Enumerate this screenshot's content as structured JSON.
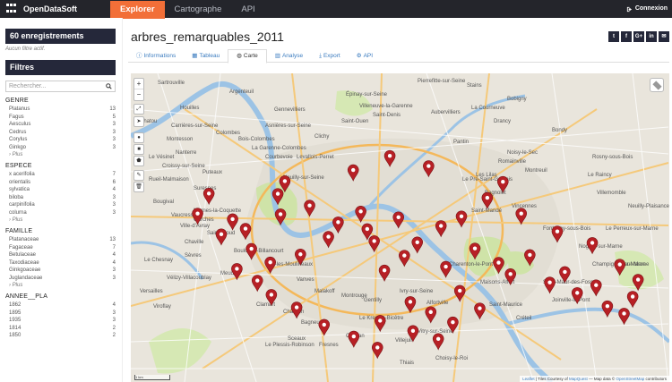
{
  "app": {
    "name": "OpenDataSoft",
    "logo_icon": "opendatasoft-logo-icon"
  },
  "nav": {
    "items": [
      "Explorer",
      "Cartographe",
      "API"
    ],
    "active_index": 0
  },
  "header": {
    "connexion_label": "Connexion"
  },
  "sidebar": {
    "count_label": "60 enregistrements",
    "no_filter": "Aucun filtre actif.",
    "filters_title": "Filtres",
    "search_placeholder": "Rechercher...",
    "groups": [
      {
        "title": "GENRE",
        "items": [
          [
            "Platanus",
            "13"
          ],
          [
            "Fagus",
            "5"
          ],
          [
            "Aesculus",
            "3"
          ],
          [
            "Cedrus",
            "3"
          ],
          [
            "Corylus",
            "3"
          ],
          [
            "Ginkgo",
            "3"
          ]
        ],
        "more": "› Plus"
      },
      {
        "title": "ESPECE",
        "items": [
          [
            "x acerifolia",
            "7"
          ],
          [
            "orientalis",
            "6"
          ],
          [
            "sylvatica",
            "4"
          ],
          [
            "biloba",
            "3"
          ],
          [
            "carpinifolia",
            "3"
          ],
          [
            "colurna",
            "3"
          ]
        ],
        "more": "› Plus"
      },
      {
        "title": "FAMILLE",
        "items": [
          [
            "Platanaceae",
            "13"
          ],
          [
            "Fagaceae",
            "7"
          ],
          [
            "Betulaceae",
            "4"
          ],
          [
            "Taxodiaceae",
            "4"
          ],
          [
            "Ginkgoaceae",
            "3"
          ],
          [
            "Juglandaceae",
            "3"
          ]
        ],
        "more": "› Plus"
      },
      {
        "title": "ANNEE__PLA",
        "items": [
          [
            "1862",
            "4"
          ],
          [
            "1895",
            "3"
          ],
          [
            "1935",
            "3"
          ],
          [
            "1814",
            "2"
          ],
          [
            "1850",
            "2"
          ]
        ],
        "more": ""
      }
    ]
  },
  "main": {
    "title": "arbres_remarquables_2011",
    "social": [
      "t",
      "f",
      "G+",
      "in",
      "✉"
    ],
    "tabs": [
      "Informations",
      "Tableau",
      "Carte",
      "Analyse",
      "Export",
      "API"
    ],
    "active_tab": 2
  },
  "map": {
    "zoom_in": "+",
    "zoom_out": "−",
    "attribution_leaflet": "Leaflet",
    "attribution_text": "| Tiles Courtesy of",
    "attribution_mapquest": "MapQuest",
    "attribution_osm_prefix": "— Map data ©",
    "attribution_osm": "OpenStreetMap",
    "attribution_suffix": "contributors",
    "scale_label": "1 km",
    "place_labels": [
      "Sartrouville",
      "Argenteuil",
      "Gennevilliers",
      "Saint-Denis",
      "Aubervilliers",
      "Bobigny",
      "Montreuil",
      "Vincennes",
      "Nanterre",
      "Colombes",
      "Clichy",
      "Saint-Ouen",
      "Pantin",
      "Bondy",
      "Rosny-sous-Bois",
      "Rueil-Malmaison",
      "Suresnes",
      "Puteaux",
      "Neuilly-sur-Seine",
      "Boulogne-Billancourt",
      "Saint-Cloud",
      "Sèvres",
      "Issy-les-Moulineaux",
      "Vanves",
      "Malakoff",
      "Montrouge",
      "Gentilly",
      "Ivry-sur-Seine",
      "Vitry-sur-Seine",
      "Créteil",
      "Charenton-le-Pont",
      "Saint-Maur-des-Fossés",
      "Champigny-sur-Marne",
      "Nogent-sur-Marne",
      "Fontenay-sous-Bois",
      "Chatou",
      "Le Chesnay",
      "Versailles",
      "Viroflay",
      "Meudon",
      "Clamart",
      "Châtillon",
      "Bagneux",
      "Le Kremlin-Bicêtre",
      "Villejuif",
      "Fresnes",
      "Sceaux",
      "Le Plessis-Robinson",
      "Cachan",
      "Thiais",
      "Choisy-le-Roi",
      "Alfortville",
      "Maisons-Alfort",
      "Saint-Maurice",
      "Joinville-le-Pont",
      "Bry-sur-Marne",
      "Le Perreux-sur-Marne",
      "Neuilly-Plaisance",
      "Villemomble",
      "Le Raincy",
      "Drancy",
      "La Courneuve",
      "Stains",
      "Pierrefitte-sur-Seine",
      "Épinay-sur-Seine",
      "Villeneuve-la-Garenne",
      "Asnières-sur-Seine",
      "Bois-Colombes",
      "Courbevoie",
      "La Garenne-Colombes",
      "Levallois-Perret",
      "Houilles",
      "Montesson",
      "Carrières-sur-Seine",
      "Le Vésinet",
      "Croissy-sur-Seine",
      "Bougival",
      "Vaucresson",
      "Garches",
      "Ville-d'Avray",
      "Marnes-la-Coquette",
      "Chaville",
      "Vélizy-Villacoublay",
      "Noisy-le-Sec",
      "Romainville",
      "Les Lilas",
      "Bagnolet",
      "Le Pré-Saint-Gervais",
      "Saint-Mandé"
    ],
    "markers": [
      [
        14.5,
        42.4
      ],
      [
        27.3,
        42.5
      ],
      [
        28.6,
        38.4
      ],
      [
        41.3,
        34.8
      ],
      [
        48.1,
        30.2
      ],
      [
        55.3,
        33.5
      ],
      [
        69.1,
        38.6
      ],
      [
        27.8,
        49.1
      ],
      [
        33.2,
        46.3
      ],
      [
        38.5,
        51.7
      ],
      [
        42.7,
        48.2
      ],
      [
        43.9,
        53.9
      ],
      [
        49.7,
        50.1
      ],
      [
        53.2,
        58.2
      ],
      [
        57.6,
        52.9
      ],
      [
        61.4,
        49.8
      ],
      [
        66.2,
        43.8
      ],
      [
        72.5,
        48.9
      ],
      [
        79.2,
        54.7
      ],
      [
        85.7,
        58.4
      ],
      [
        16.8,
        55.6
      ],
      [
        22.4,
        60.3
      ],
      [
        25.9,
        64.7
      ],
      [
        31.5,
        62.1
      ],
      [
        36.7,
        56.4
      ],
      [
        45.2,
        57.8
      ],
      [
        50.8,
        62.5
      ],
      [
        47.1,
        67.3
      ],
      [
        58.5,
        66.1
      ],
      [
        63.9,
        60.2
      ],
      [
        68.3,
        64.8
      ],
      [
        74.1,
        62.3
      ],
      [
        80.6,
        67.8
      ],
      [
        86.4,
        72.1
      ],
      [
        90.8,
        65.4
      ],
      [
        93.2,
        75.8
      ],
      [
        12.4,
        48.9
      ],
      [
        18.9,
        50.7
      ],
      [
        21.3,
        53.8
      ],
      [
        61.1,
        73.9
      ],
      [
        70.5,
        68.5
      ],
      [
        77.8,
        71.2
      ],
      [
        82.9,
        74.6
      ],
      [
        88.5,
        78.9
      ],
      [
        91.6,
        81.3
      ],
      [
        94.2,
        70.3
      ],
      [
        46.3,
        83.6
      ],
      [
        51.9,
        77.5
      ],
      [
        55.7,
        80.8
      ],
      [
        59.8,
        84.1
      ],
      [
        64.8,
        79.6
      ],
      [
        52.4,
        86.9
      ],
      [
        57.1,
        89.5
      ],
      [
        45.8,
        92.3
      ],
      [
        41.4,
        88.7
      ],
      [
        35.9,
        84.9
      ],
      [
        30.8,
        79.3
      ],
      [
        26.1,
        75.2
      ],
      [
        23.5,
        70.6
      ],
      [
        19.7,
        66.8
      ]
    ]
  }
}
